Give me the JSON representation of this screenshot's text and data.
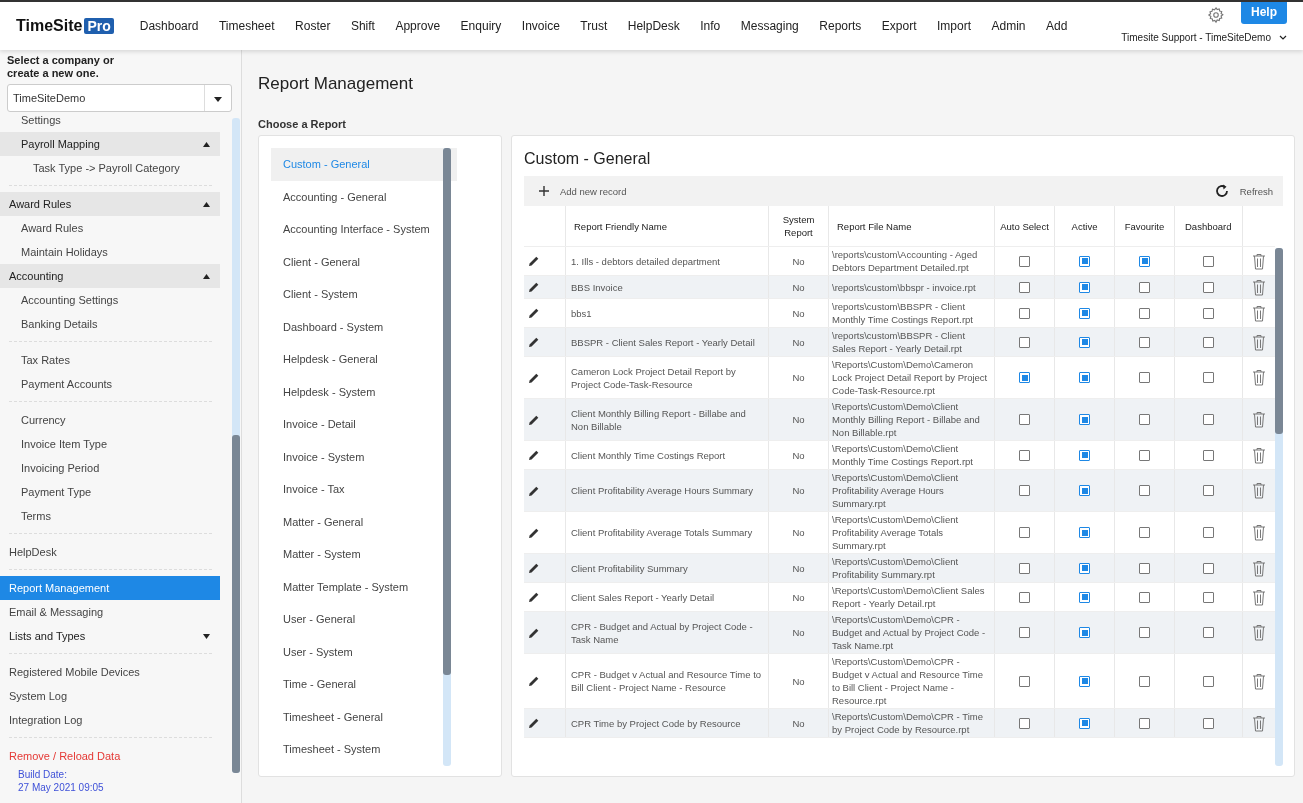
{
  "header": {
    "logo_text": "TimeSite",
    "logo_badge": "Pro",
    "nav": [
      "Dashboard",
      "Timesheet",
      "Roster",
      "Shift",
      "Approve",
      "Enquiry",
      "Invoice",
      "Trust",
      "HelpDesk",
      "Info",
      "Messaging",
      "Reports",
      "Export",
      "Import",
      "Admin",
      "Add"
    ],
    "help_button": "Help",
    "user_menu": "Timesite Support - TimeSiteDemo"
  },
  "sidebar": {
    "company_prompt": "Select a company or create a new one.",
    "company_select": "TimeSiteDemo",
    "items": [
      {
        "kind": "child",
        "label": "Settings",
        "selected": false
      },
      {
        "kind": "subgroup",
        "label": "Payroll Mapping",
        "expanded": true,
        "selected": false
      },
      {
        "kind": "grandchild",
        "label": "Task Type -> Payroll Category",
        "selected": false
      },
      {
        "kind": "separator"
      },
      {
        "kind": "group",
        "label": "Award Rules",
        "expanded": true,
        "selected": false
      },
      {
        "kind": "child",
        "label": "Award Rules",
        "selected": false
      },
      {
        "kind": "child",
        "label": "Maintain Holidays",
        "selected": false
      },
      {
        "kind": "group",
        "label": "Accounting",
        "expanded": true,
        "selected": false
      },
      {
        "kind": "child",
        "label": "Accounting Settings",
        "selected": false
      },
      {
        "kind": "child",
        "label": "Banking Details",
        "selected": false
      },
      {
        "kind": "separator"
      },
      {
        "kind": "child",
        "label": "Tax Rates",
        "selected": false
      },
      {
        "kind": "child",
        "label": "Payment Accounts",
        "selected": false
      },
      {
        "kind": "separator"
      },
      {
        "kind": "child",
        "label": "Currency",
        "selected": false
      },
      {
        "kind": "child",
        "label": "Invoice Item Type",
        "selected": false
      },
      {
        "kind": "child",
        "label": "Invoicing Period",
        "selected": false
      },
      {
        "kind": "child",
        "label": "Payment Type",
        "selected": false
      },
      {
        "kind": "child",
        "label": "Terms",
        "selected": false
      },
      {
        "kind": "separator"
      },
      {
        "kind": "item",
        "label": "HelpDesk",
        "selected": false
      },
      {
        "kind": "separator"
      },
      {
        "kind": "item",
        "label": "Report Management",
        "selected": true
      },
      {
        "kind": "item",
        "label": "Email & Messaging",
        "selected": false
      },
      {
        "kind": "expander",
        "label": "Lists and Types",
        "expanded": false,
        "selected": false
      },
      {
        "kind": "separator"
      },
      {
        "kind": "item",
        "label": "Registered Mobile Devices",
        "selected": false
      },
      {
        "kind": "item",
        "label": "System Log",
        "selected": false
      },
      {
        "kind": "item",
        "label": "Integration Log",
        "selected": false
      },
      {
        "kind": "separator"
      },
      {
        "kind": "danger",
        "label": "Remove / Reload Data",
        "selected": false
      }
    ],
    "build_label": "Build Date:",
    "build_date": "27 May 2021 09:05"
  },
  "page_title": "Report Management",
  "report_picker": {
    "label": "Choose a Report",
    "reports": [
      {
        "label": "Custom - General",
        "selected": true
      },
      {
        "label": "Accounting - General",
        "selected": false
      },
      {
        "label": "Accounting Interface - System",
        "selected": false
      },
      {
        "label": "Client - General",
        "selected": false
      },
      {
        "label": "Client - System",
        "selected": false
      },
      {
        "label": "Dashboard - System",
        "selected": false
      },
      {
        "label": "Helpdesk - General",
        "selected": false
      },
      {
        "label": "Helpdesk - System",
        "selected": false
      },
      {
        "label": "Invoice - Detail",
        "selected": false
      },
      {
        "label": "Invoice - System",
        "selected": false
      },
      {
        "label": "Invoice - Tax",
        "selected": false
      },
      {
        "label": "Matter - General",
        "selected": false
      },
      {
        "label": "Matter - System",
        "selected": false
      },
      {
        "label": "Matter Template - System",
        "selected": false
      },
      {
        "label": "User - General",
        "selected": false
      },
      {
        "label": "User - System",
        "selected": false
      },
      {
        "label": "Time - General",
        "selected": false
      },
      {
        "label": "Timesheet - General",
        "selected": false
      },
      {
        "label": "Timesheet - System",
        "selected": false
      }
    ]
  },
  "grid": {
    "title": "Custom - General",
    "add_button": "Add new record",
    "refresh_button": "Refresh",
    "columns": [
      "Report Friendly Name",
      "System Report",
      "Report File Name",
      "Auto Select",
      "Active",
      "Favourite",
      "Dashboard"
    ],
    "rows": [
      {
        "name": "1. Ills - debtors detailed department",
        "system": "No",
        "file": "\\reports\\custom\\Accounting - Aged Debtors Department Detailed.rpt",
        "auto_select": false,
        "active": true,
        "favourite": true,
        "dashboard": false
      },
      {
        "name": "BBS Invoice",
        "system": "No",
        "file": "\\reports\\custom\\bbspr - invoice.rpt",
        "auto_select": false,
        "active": true,
        "favourite": false,
        "dashboard": false
      },
      {
        "name": "bbs1",
        "system": "No",
        "file": "\\reports\\custom\\BBSPR - Client Monthly Time Costings Report.rpt",
        "auto_select": false,
        "active": true,
        "favourite": false,
        "dashboard": false
      },
      {
        "name": "BBSPR - Client Sales Report - Yearly Detail",
        "system": "No",
        "file": "\\reports\\custom\\BBSPR - Client Sales Report - Yearly Detail.rpt",
        "auto_select": false,
        "active": true,
        "favourite": false,
        "dashboard": false
      },
      {
        "name": "Cameron Lock Project Detail Report by Project Code-Task-Resource",
        "system": "No",
        "file": "\\Reports\\Custom\\Demo\\Cameron Lock Project Detail Report by Project Code-Task-Resource.rpt",
        "auto_select": true,
        "active": true,
        "favourite": false,
        "dashboard": false
      },
      {
        "name": "Client Monthly Billing Report - Billabe and Non Billable",
        "system": "No",
        "file": "\\Reports\\Custom\\Demo\\Client Monthly Billing Report - Billabe and Non Billable.rpt",
        "auto_select": false,
        "active": true,
        "favourite": false,
        "dashboard": false
      },
      {
        "name": "Client Monthly Time Costings Report",
        "system": "No",
        "file": "\\Reports\\Custom\\Demo\\Client Monthly Time Costings Report.rpt",
        "auto_select": false,
        "active": true,
        "favourite": false,
        "dashboard": false
      },
      {
        "name": "Client Profitability Average Hours Summary",
        "system": "No",
        "file": "\\Reports\\Custom\\Demo\\Client Profitability Average Hours Summary.rpt",
        "auto_select": false,
        "active": true,
        "favourite": false,
        "dashboard": false
      },
      {
        "name": "Client Profitability Average Totals Summary",
        "system": "No",
        "file": "\\Reports\\Custom\\Demo\\Client Profitability Average Totals Summary.rpt",
        "auto_select": false,
        "active": true,
        "favourite": false,
        "dashboard": false
      },
      {
        "name": "Client Profitability Summary",
        "system": "No",
        "file": "\\Reports\\Custom\\Demo\\Client Profitability Summary.rpt",
        "auto_select": false,
        "active": true,
        "favourite": false,
        "dashboard": false
      },
      {
        "name": "Client Sales Report - Yearly Detail",
        "system": "No",
        "file": "\\Reports\\Custom\\Demo\\Client Sales Report - Yearly Detail.rpt",
        "auto_select": false,
        "active": true,
        "favourite": false,
        "dashboard": false
      },
      {
        "name": "CPR - Budget and Actual by Project Code - Task Name",
        "system": "No",
        "file": "\\Reports\\Custom\\Demo\\CPR - Budget and Actual by Project Code - Task Name.rpt",
        "auto_select": false,
        "active": true,
        "favourite": false,
        "dashboard": false
      },
      {
        "name": "CPR - Budget v Actual and Resource Time to Bill Client - Project Name - Resource",
        "system": "No",
        "file": "\\Reports\\Custom\\Demo\\CPR - Budget v Actual and Resource Time to Bill Client - Project Name - Resource.rpt",
        "auto_select": false,
        "active": true,
        "favourite": false,
        "dashboard": false
      },
      {
        "name": "CPR Time by Project Code by Resource",
        "system": "No",
        "file": "\\Reports\\Custom\\Demo\\CPR - Time by Project Code by Resource.rpt",
        "auto_select": false,
        "active": true,
        "favourite": false,
        "dashboard": false
      }
    ]
  }
}
